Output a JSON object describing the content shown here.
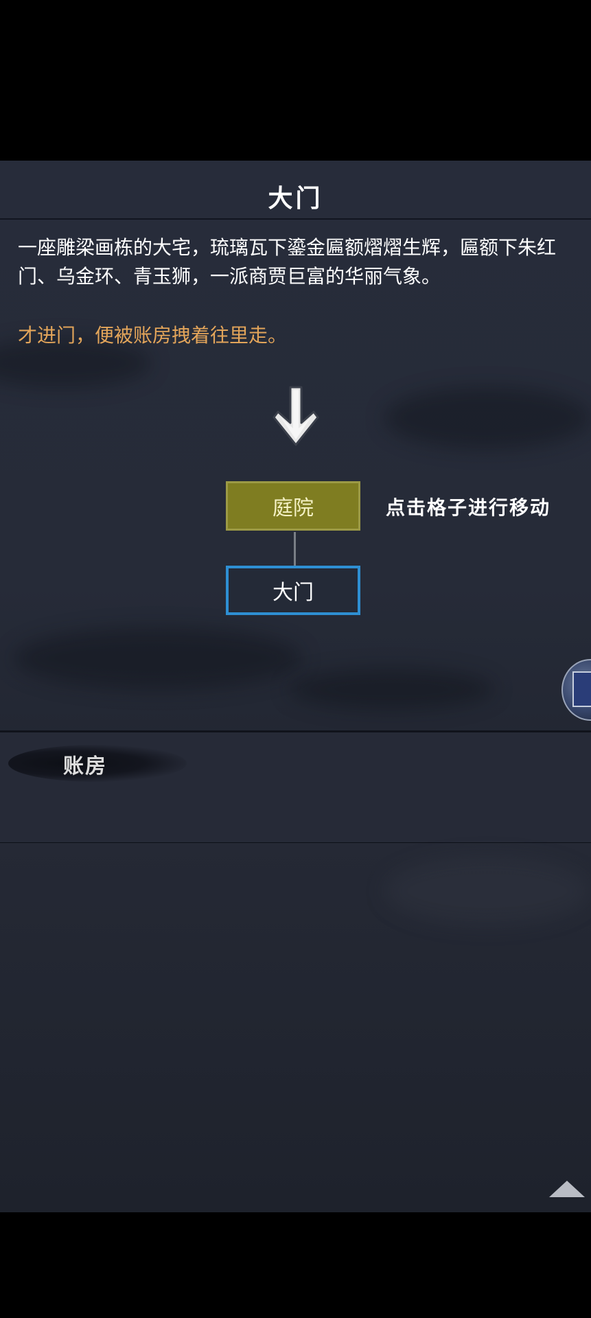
{
  "location": {
    "title": "大门",
    "description": "一座雕梁画栋的大宅，琉璃瓦下鎏金匾额熠熠生辉，匾额下朱红门、乌金环、青玉狮，一派商贾巨富的华丽气象。",
    "event": "才进门，便被账房拽着往里走。"
  },
  "map": {
    "cells": [
      {
        "label": "庭院",
        "state": "adjacent"
      },
      {
        "label": "大门",
        "state": "current"
      }
    ],
    "hint": "点击格子进行移动",
    "colors": {
      "adjacent_fill": "#7f7d21",
      "current_border": "#2e8fd3"
    }
  },
  "npcs": [
    {
      "name": "账房"
    }
  ],
  "icons": {
    "arrow": "down-arrow-icon",
    "token": "scroll-book-icon",
    "collapse": "triangle-up-icon"
  }
}
